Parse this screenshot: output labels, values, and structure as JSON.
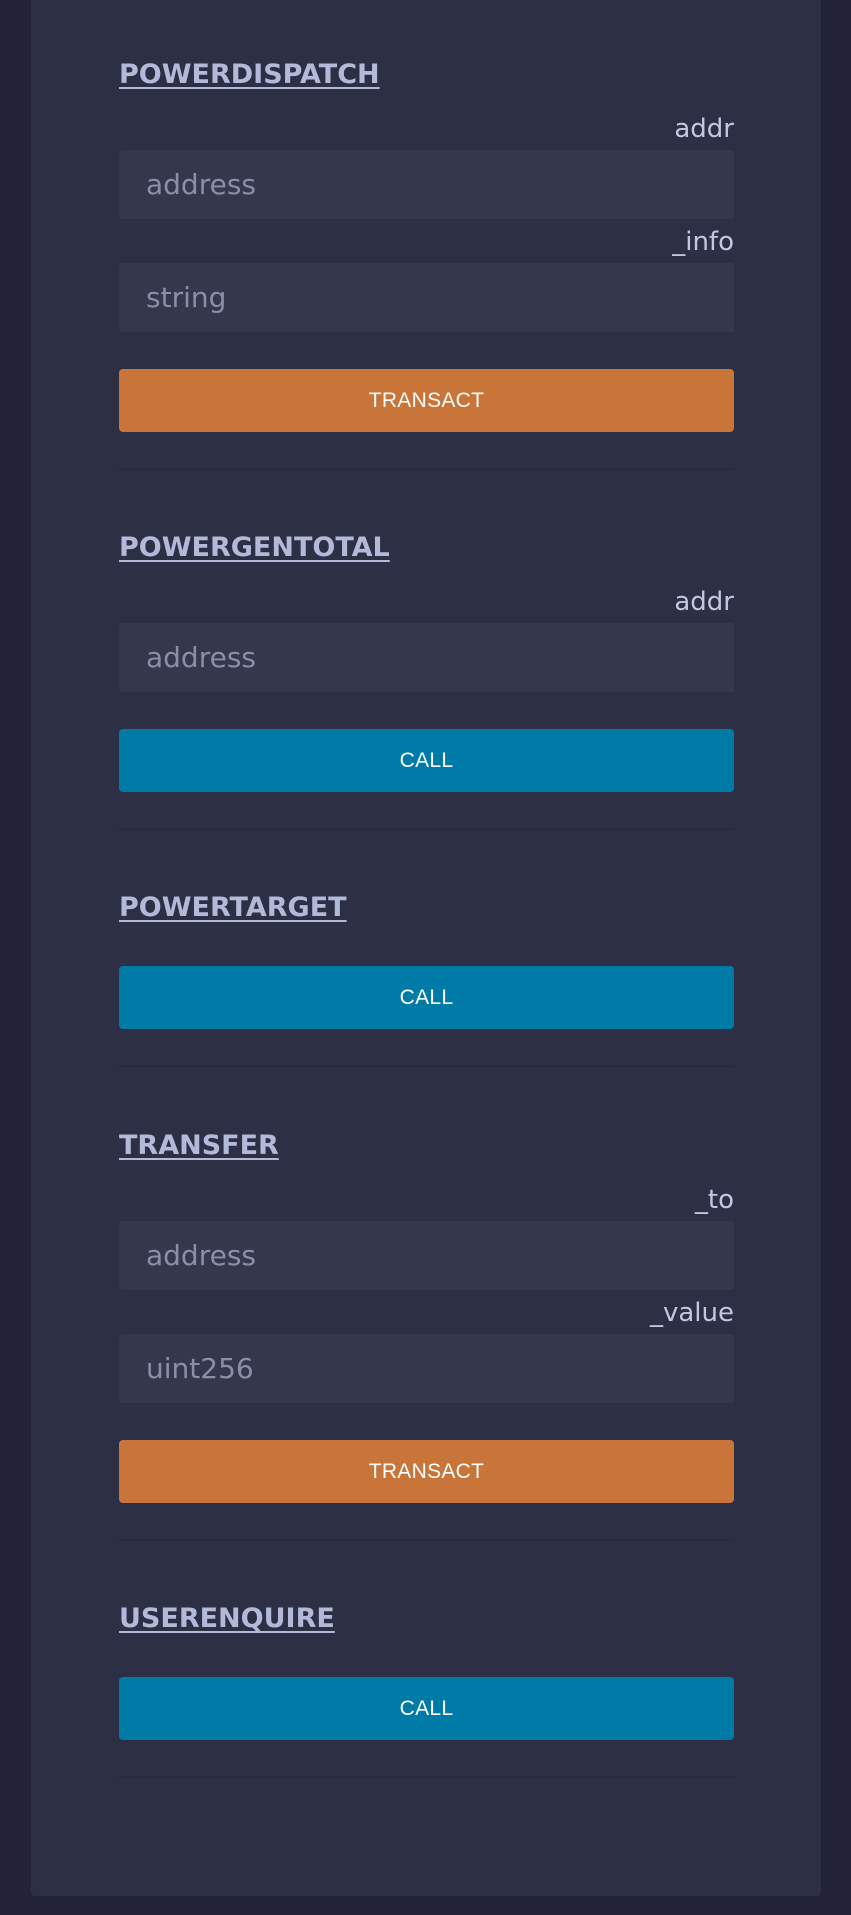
{
  "functions": [
    {
      "name": "POWERDISPATCH",
      "params": [
        {
          "label": "addr",
          "placeholder": "address"
        },
        {
          "label": "_info",
          "placeholder": "string"
        }
      ],
      "button": "TRANSACT"
    },
    {
      "name": "POWERGENTOTAL",
      "params": [
        {
          "label": "addr",
          "placeholder": "address"
        }
      ],
      "button": "CALL"
    },
    {
      "name": "POWERTARGET",
      "params": [],
      "button": "CALL"
    },
    {
      "name": "TRANSFER",
      "params": [
        {
          "label": "_to",
          "placeholder": "address"
        },
        {
          "label": "_value",
          "placeholder": "uint256"
        }
      ],
      "button": "TRANSACT"
    },
    {
      "name": "USERENQUIRE",
      "params": [],
      "button": "CALL"
    }
  ],
  "colors": {
    "page_bg": "#222336",
    "panel_bg": "#2d2f45",
    "input_bg": "#35374d",
    "title": "#b3b9d8",
    "transact": "#c97539",
    "call": "#007aa6"
  }
}
